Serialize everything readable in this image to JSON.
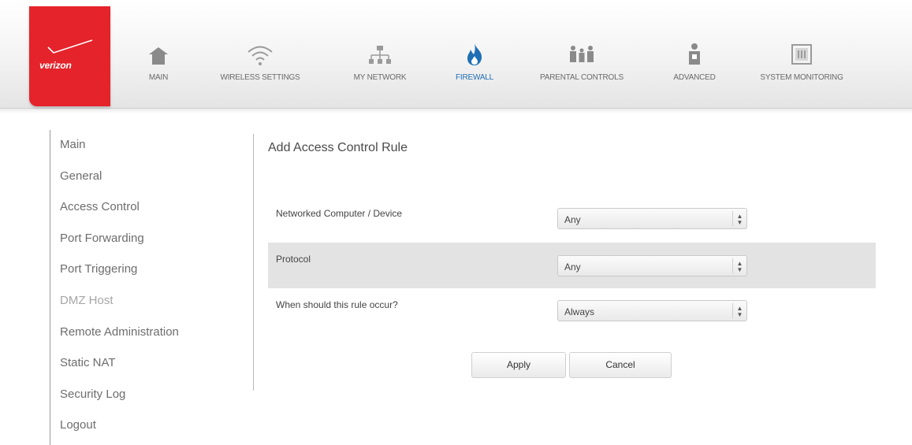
{
  "brand": {
    "logo_text": "verizon"
  },
  "nav": [
    {
      "label": "MAIN",
      "icon": "house-icon"
    },
    {
      "label": "WIRELESS SETTINGS",
      "icon": "wifi-icon"
    },
    {
      "label": "MY NETWORK",
      "icon": "network-icon"
    },
    {
      "label": "FIREWALL",
      "icon": "flame-icon",
      "active": true
    },
    {
      "label": "PARENTAL CONTROLS",
      "icon": "family-icon"
    },
    {
      "label": "ADVANCED",
      "icon": "person-icon"
    },
    {
      "label": "SYSTEM MONITORING",
      "icon": "monitor-icon"
    }
  ],
  "sidebar": {
    "items": [
      {
        "label": "Main"
      },
      {
        "label": "General"
      },
      {
        "label": "Access Control"
      },
      {
        "label": "Port Forwarding"
      },
      {
        "label": "Port Triggering"
      },
      {
        "label": "DMZ Host"
      },
      {
        "label": "Remote Administration"
      },
      {
        "label": "Static NAT"
      },
      {
        "label": "Security Log"
      },
      {
        "label": "Logout"
      }
    ]
  },
  "page": {
    "title": "Add Access Control Rule"
  },
  "form": {
    "rows": [
      {
        "label": "Networked Computer / Device",
        "value": "Any"
      },
      {
        "label": "Protocol",
        "value": "Any"
      },
      {
        "label": "When should this rule occur?",
        "value": "Always"
      }
    ],
    "apply_label": "Apply",
    "cancel_label": "Cancel"
  },
  "colors": {
    "brand_red": "#e4232b",
    "active_nav": "#1f6fb5",
    "icon_gray": "#8a8a8a"
  }
}
